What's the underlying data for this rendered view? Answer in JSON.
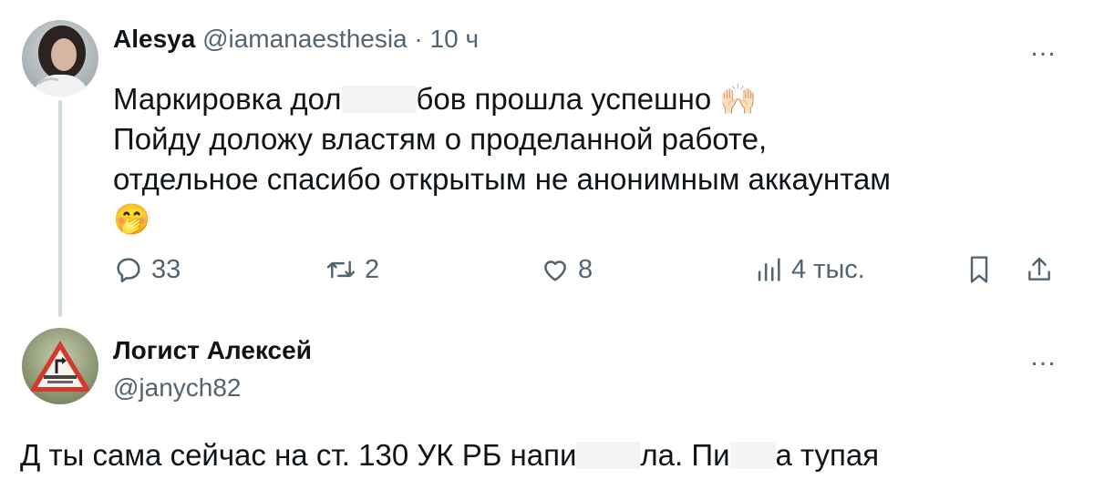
{
  "tweet": {
    "author_name": "Alesya",
    "author_handle": "@iamanaesthesia",
    "separator": "·",
    "time": "10 ч",
    "text_line1_a": "Маркировка дол",
    "text_line1_b": "бов прошла успешно",
    "text_line1_emoji": "🙌🏻",
    "text_line2": "Пойду доложу властям о проделанной работе,",
    "text_line3": "отдельное спасибо открытым не анонимным аккаунтам",
    "text_line4_emoji": "🤭",
    "actions": {
      "replies": "33",
      "reposts": "2",
      "likes": "8",
      "views": "4 тыс."
    },
    "more_icon": "…"
  },
  "reply": {
    "author_name": "Логист Алексей",
    "author_handle": "@janych82",
    "more_icon": "…",
    "text_a": "Д ты сама сейчас на ст. 130 УК РБ напи",
    "text_b": "ла.  Пи",
    "text_c": "а тупая"
  },
  "colors": {
    "text": "#0f1419",
    "secondary": "#536471",
    "thread_line": "#cfd9de",
    "redaction": "#f3f4f6"
  }
}
